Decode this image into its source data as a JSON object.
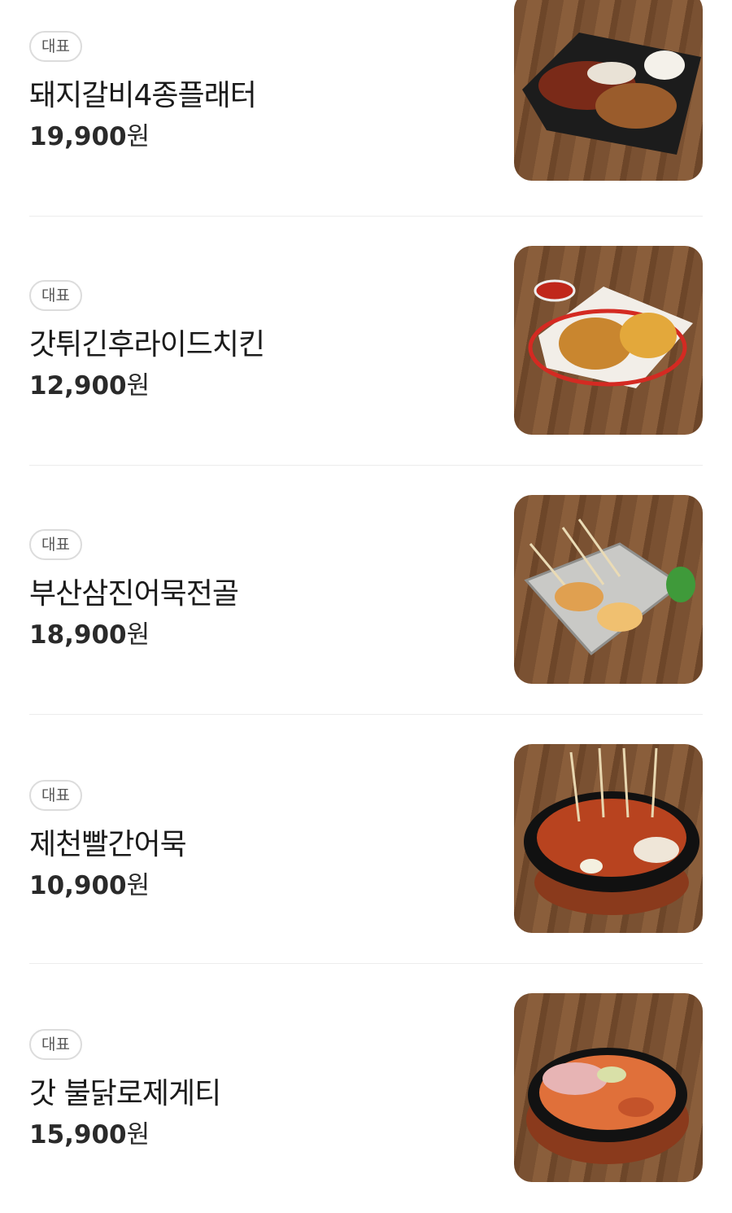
{
  "badge_label": "대표",
  "currency": "원",
  "items": [
    {
      "name": "돼지갈비4종플래터",
      "price": "19,900",
      "image_icon": "platter-food-image"
    },
    {
      "name": "갓튀긴후라이드치킨",
      "price": "12,900",
      "image_icon": "fried-chicken-image"
    },
    {
      "name": "부산삼진어묵전골",
      "price": "18,900",
      "image_icon": "fishcake-hotpot-image"
    },
    {
      "name": "제천빨간어묵",
      "price": "10,900",
      "image_icon": "red-fishcake-image"
    },
    {
      "name": "갓 불닭로제게티",
      "price": "15,900",
      "image_icon": "rose-pasta-image"
    }
  ],
  "colors": {
    "badge_border": "#dcdcdc",
    "divider": "#ececec",
    "text": "#1b1b1b"
  }
}
